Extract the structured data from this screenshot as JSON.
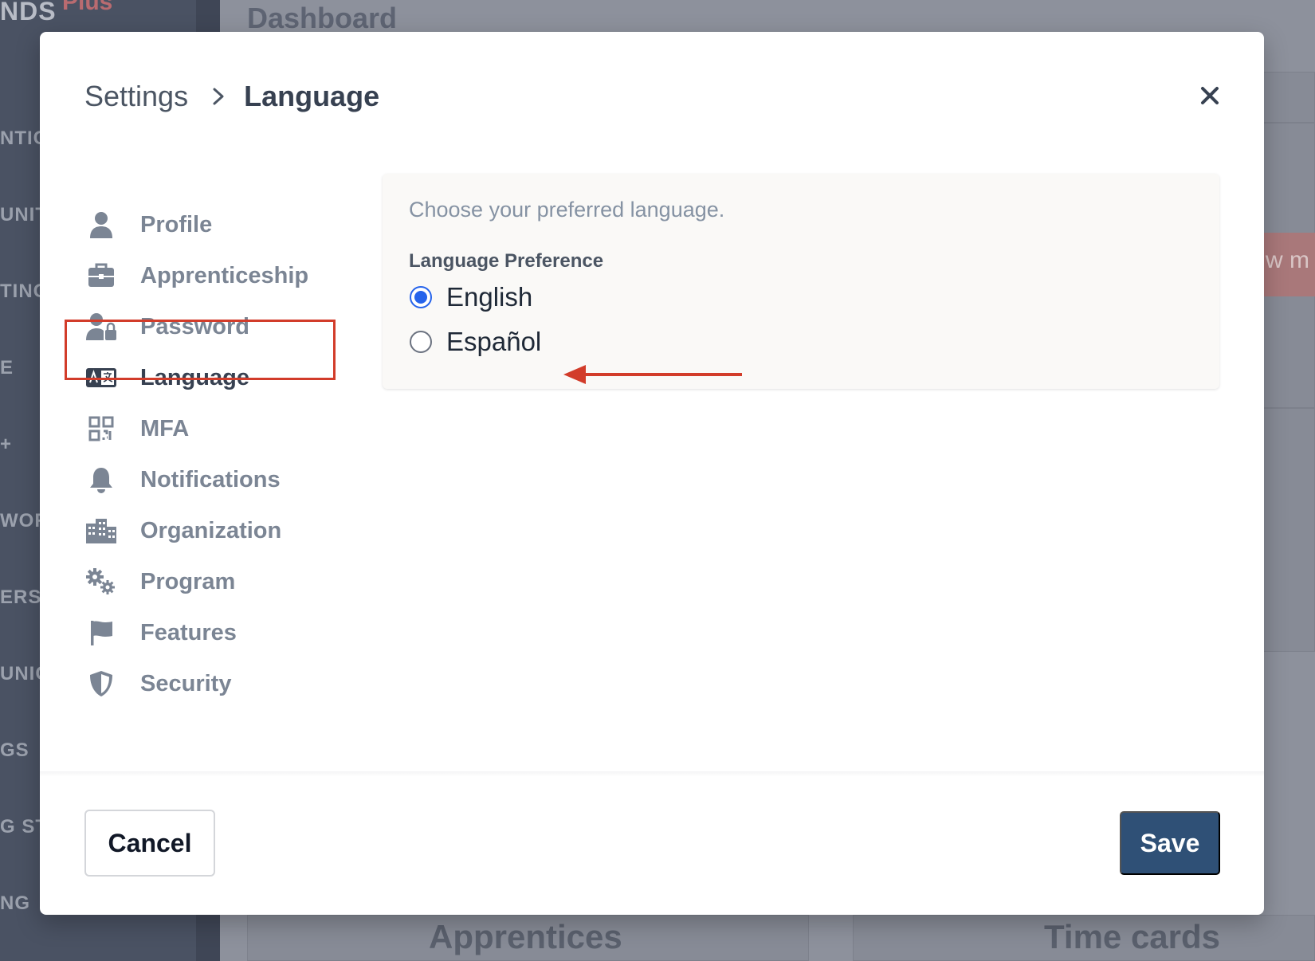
{
  "background": {
    "brand": "NDS",
    "brand_suffix": "Plus",
    "page_title": "Dashboard",
    "sidebar_fragments": [
      "NTIC",
      "UNITY",
      "TING",
      "E",
      "+",
      "WOR",
      "ERS",
      "UNIC",
      "GS",
      "G ST",
      "NG"
    ],
    "button_fragment": "w m",
    "card_titles": [
      "Apprentices",
      "Time cards"
    ]
  },
  "modal": {
    "breadcrumb": {
      "root": "Settings",
      "current": "Language"
    },
    "close_icon": "close-icon",
    "nav": [
      {
        "label": "Profile",
        "icon": "user-icon"
      },
      {
        "label": "Apprenticeship",
        "icon": "briefcase-icon"
      },
      {
        "label": "Password",
        "icon": "user-lock-icon"
      },
      {
        "label": "Language",
        "icon": "language-icon",
        "active": true
      },
      {
        "label": "MFA",
        "icon": "qr-code-icon"
      },
      {
        "label": "Notifications",
        "icon": "bell-icon"
      },
      {
        "label": "Organization",
        "icon": "building-icon"
      },
      {
        "label": "Program",
        "icon": "gears-icon"
      },
      {
        "label": "Features",
        "icon": "flag-icon"
      },
      {
        "label": "Security",
        "icon": "shield-icon"
      }
    ],
    "content": {
      "description": "Choose your preferred language.",
      "field_label": "Language Preference",
      "options": [
        {
          "label": "English",
          "selected": true
        },
        {
          "label": "Español",
          "selected": false
        }
      ]
    },
    "footer": {
      "cancel_label": "Cancel",
      "save_label": "Save"
    }
  },
  "colors": {
    "accent": "#2563eb",
    "save_button": "#2f5076",
    "highlight_annotation": "#d23c2a"
  }
}
